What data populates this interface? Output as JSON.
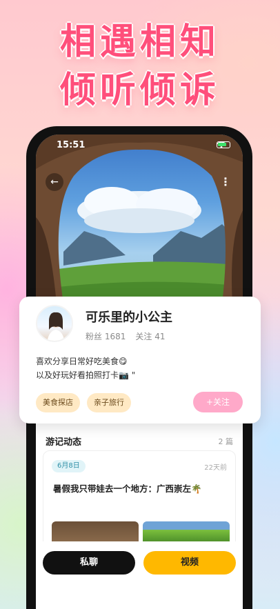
{
  "promo": {
    "headline_line1": "相遇相知",
    "headline_line2": "倾听倾诉"
  },
  "status_bar": {
    "time": "15:51"
  },
  "profile": {
    "nickname": "可乐里的小公主",
    "fans_label": "粉丝",
    "fans_count": "1681",
    "following_label": "关注",
    "following_count": "41",
    "bio_line1": "喜欢分享日常好吃美食😋",
    "bio_line2": "以及好玩好看拍照打卡📷 \"",
    "tags": [
      "美食探店",
      "亲子旅行"
    ],
    "follow_button": "+关注"
  },
  "journal": {
    "title": "游记动态",
    "count": "2 篇",
    "posts": [
      {
        "date": "6月8日",
        "ago": "22天前",
        "title": "暑假我只带娃去一个地方：广西崇左🌴"
      }
    ]
  },
  "actions": {
    "chat": "私聊",
    "video": "视频"
  },
  "colors": {
    "headline": "#ff4f7b",
    "follow_button": "#ffa9c9",
    "video_button": "#ffb800",
    "tag_bg": "#ffe9c4"
  }
}
